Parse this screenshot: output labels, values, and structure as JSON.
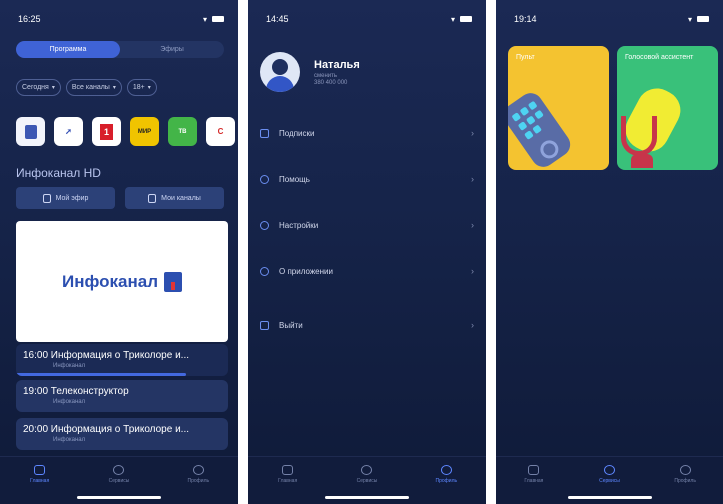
{
  "screen1": {
    "status_time": "16:25",
    "segments": [
      "Программа",
      "Эфиры"
    ],
    "filters": [
      "Сегодня",
      "Все каналы",
      "18+"
    ],
    "channels": [
      {
        "name": "info-channel-logo",
        "text": ""
      },
      {
        "name": "rocket-channel-logo",
        "text": ""
      },
      {
        "name": "channel-one-logo",
        "text": "1"
      },
      {
        "name": "mir-channel-logo",
        "text": "МИР"
      },
      {
        "name": "kids-channel-logo",
        "text": "ТВ"
      },
      {
        "name": "red-channel-logo",
        "text": "С"
      }
    ],
    "channel_title": "Инфоканал HD",
    "buttons": [
      "Мой эфир",
      "Мои каналы"
    ],
    "player_brand": "Инфоканал",
    "program": [
      {
        "title": "16:00  Информация о Триколоре и...",
        "sub": "Инфоканал"
      },
      {
        "title": "19:00  Телеконструктор",
        "sub": "Инфоканал"
      },
      {
        "title": "20:00  Информация о Триколоре и...",
        "sub": "Инфоканал"
      }
    ],
    "progress": 0.8,
    "tabs": [
      "Главная",
      "Сервисы",
      "Профиль"
    ],
    "active_tab": 0
  },
  "screen2": {
    "status_time": "14:45",
    "user_name": "Наталья",
    "user_sub": "сменить",
    "user_phone": "380 400 000",
    "menu": [
      "Подписки",
      "Помощь",
      "Настройки",
      "О приложении",
      "Выйти"
    ],
    "tabs": [
      "Главная",
      "Сервисы",
      "Профиль"
    ],
    "active_tab": 2
  },
  "screen3": {
    "status_time": "19:14",
    "cards": [
      "Пульт",
      "Голосовой ассистент"
    ],
    "tabs": [
      "Главная",
      "Сервисы",
      "Профиль"
    ],
    "active_tab": 1
  },
  "colors": {
    "bg": "#16244a",
    "accent": "#4369e0",
    "card_yellow": "#f4c330",
    "card_green": "#39c17a"
  }
}
